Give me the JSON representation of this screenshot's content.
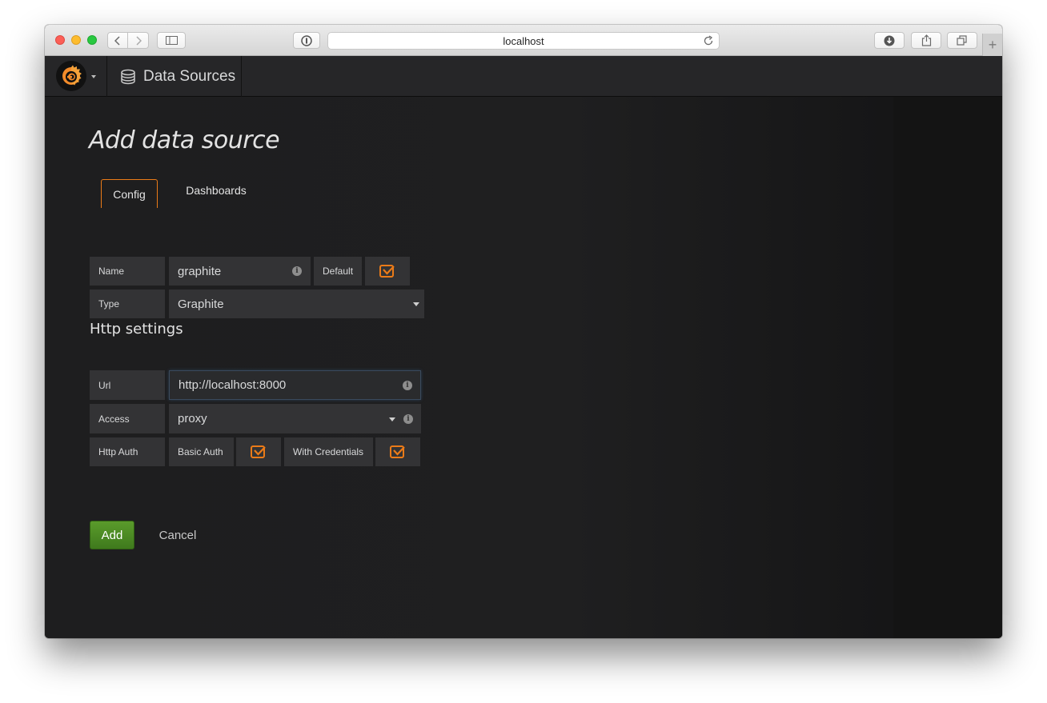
{
  "browser": {
    "url": "localhost"
  },
  "app": {
    "section": "Data Sources",
    "page_title": "Add data source",
    "tabs": [
      {
        "label": "Config",
        "active": true
      },
      {
        "label": "Dashboards",
        "active": false
      }
    ],
    "form": {
      "name_label": "Name",
      "name_value": "graphite",
      "default_label": "Default",
      "type_label": "Type",
      "type_value": "Graphite"
    },
    "http": {
      "heading": "Http settings",
      "url_label": "Url",
      "url_value": "http://localhost:8000",
      "access_label": "Access",
      "access_value": "proxy",
      "auth_label": "Http Auth",
      "basic_auth_label": "Basic Auth",
      "with_credentials_label": "With Credentials"
    },
    "actions": {
      "add_label": "Add",
      "cancel_label": "Cancel"
    },
    "colors": {
      "accent": "#eb7b18",
      "primary_button": "#4c8a23"
    },
    "icons": [
      "grafana-logo-icon",
      "database-icon",
      "info-icon",
      "checkbox-icon",
      "caret-down-icon"
    ]
  }
}
